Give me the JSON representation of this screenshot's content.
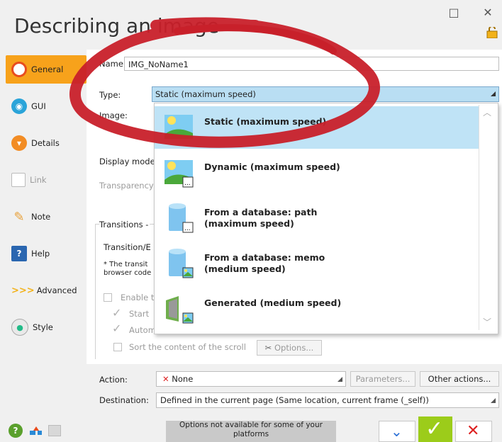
{
  "window": {
    "title": "Describing an image",
    "minimize": "□",
    "close": "✕"
  },
  "sidebar": {
    "items": [
      {
        "label": "General",
        "icon": "circle-icon",
        "state": "active"
      },
      {
        "label": "GUI",
        "icon": "eye-icon"
      },
      {
        "label": "Details",
        "icon": "details-icon"
      },
      {
        "label": "Link",
        "icon": "link-icon",
        "state": "disabled"
      },
      {
        "label": "Note",
        "icon": "pencil-icon"
      },
      {
        "label": "Help",
        "icon": "help-icon"
      },
      {
        "label": "Advanced",
        "icon": "chevrons-icon"
      },
      {
        "label": "Style",
        "icon": "palette-icon"
      }
    ]
  },
  "form": {
    "name_label": "Name:",
    "name_value": "IMG_NoName1",
    "type_label": "Type:",
    "type_value": "Static (maximum speed)",
    "image_label": "Image:",
    "display_mode_label": "Display mode:",
    "transparency_label": "Transparency",
    "transitions_label": "Transitions - ",
    "transition_effect_label": "Transition/E",
    "note_line1": "* The transit",
    "note_line2": "browser code",
    "enable_label": "Enable t",
    "start_label": "Start",
    "autom_label": "Autom",
    "sort_label": "Sort the content of the scroll",
    "options_button": "Options...",
    "action_label": "Action:",
    "action_value": "None",
    "parameters_button": "Parameters...",
    "other_actions_button": "Other actions...",
    "destination_label": "Destination:",
    "destination_value": "Defined in the current page (Same location, current frame (_self))"
  },
  "dropdown": {
    "options": [
      {
        "label": "Static (maximum speed)",
        "icon": "static-image-icon",
        "selected": true
      },
      {
        "label": "Dynamic (maximum speed)",
        "icon": "dynamic-image-icon"
      },
      {
        "label": "From a database: path (maximum speed)",
        "icon": "database-path-icon"
      },
      {
        "label": "From a database: memo (medium speed)",
        "icon": "database-memo-icon"
      },
      {
        "label": "Generated (medium speed)",
        "icon": "generated-image-icon"
      }
    ]
  },
  "footer": {
    "notice": "Options not available for some of your platforms"
  },
  "colors": {
    "accent": "#f7a21b",
    "selection": "#bfe3f6",
    "ok": "#9ccc1a",
    "annotation": "#c8202a"
  }
}
